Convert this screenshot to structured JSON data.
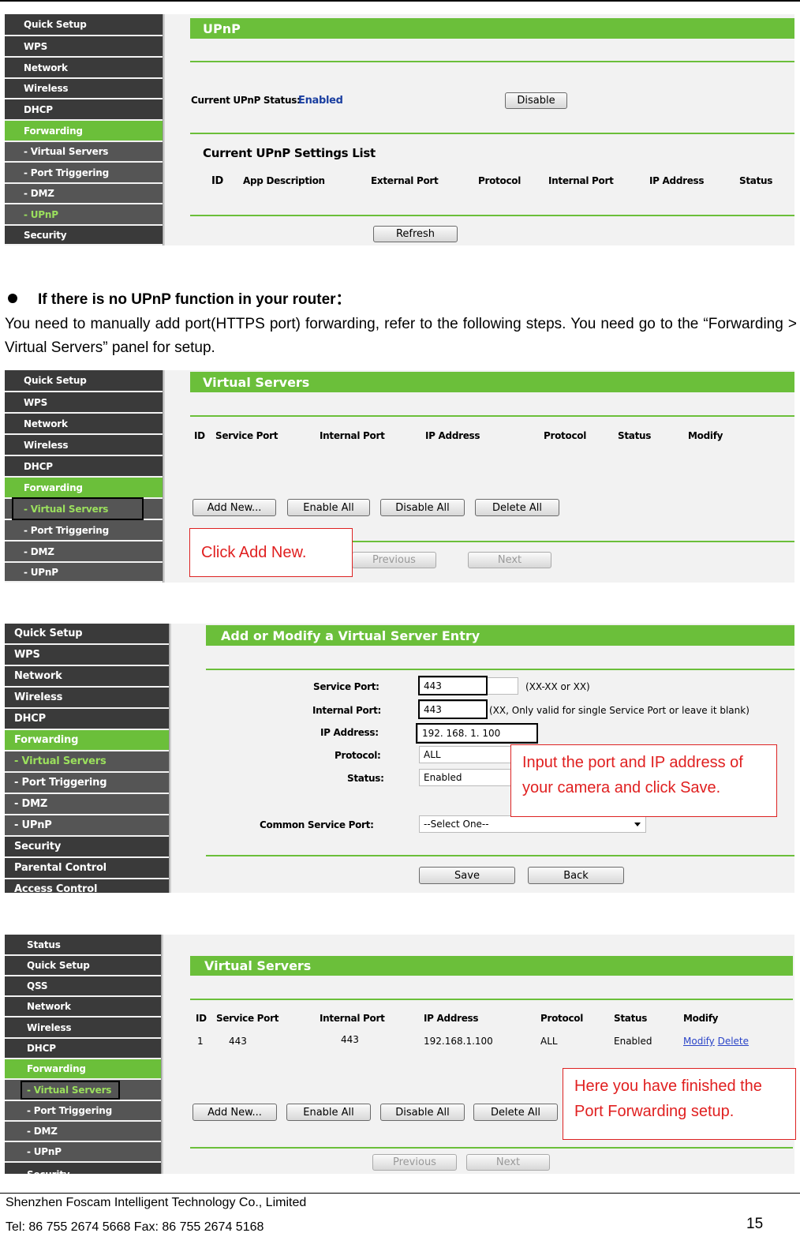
{
  "menus": {
    "upnp": [
      "Quick Setup",
      "WPS",
      "Network",
      "Wireless",
      "DHCP",
      "Forwarding",
      "- Virtual Servers",
      "- Port Triggering",
      "- DMZ",
      "- UPnP",
      "Security"
    ],
    "vs": [
      "Quick Setup",
      "WPS",
      "Network",
      "Wireless",
      "DHCP",
      "Forwarding",
      "- Virtual Servers",
      "- Port Triggering",
      "- DMZ",
      "- UPnP"
    ],
    "add": [
      "Quick Setup",
      "WPS",
      "Network",
      "Wireless",
      "DHCP",
      "Forwarding",
      "- Virtual Servers",
      "- Port Triggering",
      "- DMZ",
      "- UPnP",
      "Security",
      "Parental Control",
      "Access Control"
    ],
    "final": [
      "Status",
      "Quick Setup",
      "QSS",
      "Network",
      "Wireless",
      "DHCP",
      "Forwarding",
      "- Virtual Servers",
      "- Port Triggering",
      "- DMZ",
      "- UPnP",
      "Security"
    ]
  },
  "upnp": {
    "title": "UPnP",
    "status_label": "Current UPnP Status:",
    "status_value": "Enabled",
    "disable_btn": "Disable",
    "list_title": "Current UPnP Settings List",
    "columns": [
      "ID",
      "App Description",
      "External Port",
      "Protocol",
      "Internal Port",
      "IP Address",
      "Status"
    ],
    "refresh_btn": "Refresh"
  },
  "bullet": "If there is no UPnP function in your router：",
  "paragraph": "You need to manually add port(HTTPS port) forwarding, refer to the following steps. You need go to the “Forwarding > Virtual Servers” panel for setup.",
  "vs": {
    "title": "Virtual Servers",
    "columns": [
      "ID",
      "Service Port",
      "Internal Port",
      "IP Address",
      "Protocol",
      "Status",
      "Modify"
    ],
    "buttons": [
      "Add New...",
      "Enable All",
      "Disable All",
      "Delete All"
    ],
    "prev_btn": "Previous",
    "next_btn": "Next",
    "callout": "Click Add New."
  },
  "add": {
    "title": "Add or Modify a Virtual Server Entry",
    "service_port_label": "Service Port:",
    "service_port_value": "443",
    "service_port_hint": "(XX-XX or XX)",
    "internal_port_label": "Internal Port:",
    "internal_port_value": "443",
    "internal_port_hint": "(XX, Only valid for single Service Port or leave it blank)",
    "ip_label": "IP Address:",
    "ip_value": "192. 168. 1. 100",
    "protocol_label": "Protocol:",
    "protocol_value": "ALL",
    "status_label": "Status:",
    "status_value": "Enabled",
    "common_label": "Common Service Port:",
    "common_value": "--Select One--",
    "save_btn": "Save",
    "back_btn": "Back",
    "callout": "Input the port and IP address of your camera and click Save."
  },
  "final": {
    "title": "Virtual Servers",
    "columns": [
      "ID",
      "Service Port",
      "Internal Port",
      "IP Address",
      "Protocol",
      "Status",
      "Modify"
    ],
    "row": [
      "1",
      "443",
      "443",
      "192.168.1.100",
      "ALL",
      "Enabled"
    ],
    "modify_link": "Modify",
    "delete_link": "Delete",
    "buttons": [
      "Add New...",
      "Enable All",
      "Disable All",
      "Delete All"
    ],
    "prev_btn": "Previous",
    "next_btn": "Next",
    "callout": "Here you have finished the Port Forwarding setup."
  },
  "footer": {
    "company": "Shenzhen Foscam Intelligent Technology Co., Limited",
    "contact": "Tel: 86 755 2674 5668 Fax: 86 755 2674 5168",
    "page": "15"
  }
}
